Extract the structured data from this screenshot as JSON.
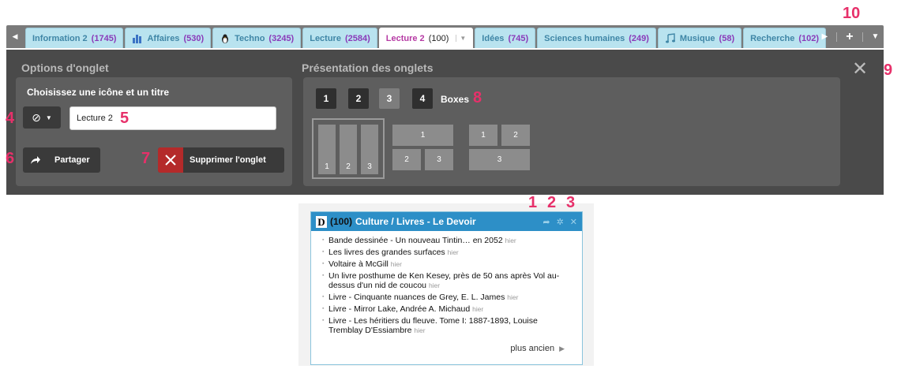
{
  "tabs": [
    {
      "label": "Information 2",
      "count": "(1745)",
      "icon": "none"
    },
    {
      "label": "Affaires",
      "count": "(530)",
      "icon": "bar-chart-icon"
    },
    {
      "label": "Techno",
      "count": "(3245)",
      "icon": "penguin-icon"
    },
    {
      "label": "Lecture",
      "count": "(2584)",
      "icon": "none"
    },
    {
      "label": "Lecture 2",
      "count": "(100)",
      "icon": "none",
      "active": true
    },
    {
      "label": "Idées",
      "count": "(745)",
      "icon": "none"
    },
    {
      "label": "Sciences humaines",
      "count": "(249)",
      "icon": "none"
    },
    {
      "label": "Musique",
      "count": "(58)",
      "icon": "music-note-icon"
    },
    {
      "label": "Recherche",
      "count": "(102)",
      "icon": "none"
    }
  ],
  "tabbar_buttons": {
    "add": "+"
  },
  "options": {
    "title": "Options d'onglet",
    "choose_label": "Choisissez une icône et un titre",
    "icon_symbol": "⊘",
    "title_value": "Lecture 2",
    "share_label": "Partager",
    "delete_label": "Supprimer l'onglet"
  },
  "presentation": {
    "title": "Présentation des onglets",
    "columns": [
      "1",
      "2",
      "3",
      "4"
    ],
    "selected_column": "3",
    "boxes_label": "Boxes",
    "layouts": [
      {
        "cells": [
          "1",
          "2",
          "3"
        ]
      },
      {
        "cells": [
          "1",
          "2",
          "3"
        ]
      },
      {
        "cells": [
          "1",
          "2",
          "3"
        ]
      }
    ]
  },
  "annotations": [
    "1",
    "2",
    "3",
    "4",
    "5",
    "6",
    "7",
    "8",
    "9",
    "10"
  ],
  "widget": {
    "count": "(100)",
    "title": "Culture / Livres - Le Devoir",
    "logo_letter": "D",
    "items": [
      {
        "text": "Bande dessinée - Un nouveau Tintin… en 2052",
        "when": "hier"
      },
      {
        "text": "Les livres des grandes surfaces",
        "when": "hier"
      },
      {
        "text": "Voltaire à McGill",
        "when": "hier"
      },
      {
        "text": "Un livre posthume de Ken Kesey, près de 50 ans après Vol au-dessus d'un nid de coucou",
        "when": "hier"
      },
      {
        "text": "Livre - Cinquante nuances de Grey, E. L. James",
        "when": "hier"
      },
      {
        "text": "Livre - Mirror Lake, Andrée A. Michaud",
        "when": "hier"
      },
      {
        "text": "Livre - Les héritiers du fleuve. Tome I: 1887-1893, Louise Tremblay D'Essiambre",
        "when": "hier"
      }
    ],
    "more_label": "plus ancien"
  },
  "colors": {
    "tab_bg": "#b9e3ef",
    "tab_text": "#3f86a6",
    "count_text": "#8a3ab9",
    "panel_bg": "#4a4a4a",
    "danger": "#b42a2a",
    "widget_header": "#2d8fc7",
    "annotation": "#e7306a"
  }
}
